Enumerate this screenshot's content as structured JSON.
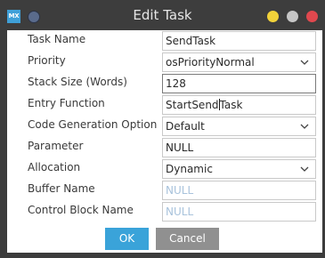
{
  "window": {
    "icon_text": "MX",
    "title": "Edit Task"
  },
  "fields": [
    {
      "label": "Task Name",
      "value": "SendTask",
      "type": "text"
    },
    {
      "label": "Priority",
      "value": "osPriorityNormal",
      "type": "select"
    },
    {
      "label": "Stack Size (Words)",
      "value": "128",
      "type": "text"
    },
    {
      "label": "Entry Function",
      "value_before_caret": "StartSend",
      "value_after_caret": "Task",
      "type": "text"
    },
    {
      "label": "Code Generation Option",
      "value": "Default",
      "type": "select"
    },
    {
      "label": "Parameter",
      "value": "NULL",
      "type": "text"
    },
    {
      "label": "Allocation",
      "value": "Dynamic",
      "type": "select"
    },
    {
      "label": "Buffer Name",
      "placeholder": "NULL",
      "type": "text"
    },
    {
      "label": "Control Block Name",
      "placeholder": "NULL",
      "type": "text"
    }
  ],
  "buttons": {
    "ok": "OK",
    "cancel": "Cancel"
  },
  "colors": {
    "titlebar": "#3d3d3d",
    "accent": "#3aa3d9",
    "cancel": "#909090",
    "close": "#e0484e",
    "minimize": "#f2d23a",
    "maximize": "#c6c6c6"
  }
}
